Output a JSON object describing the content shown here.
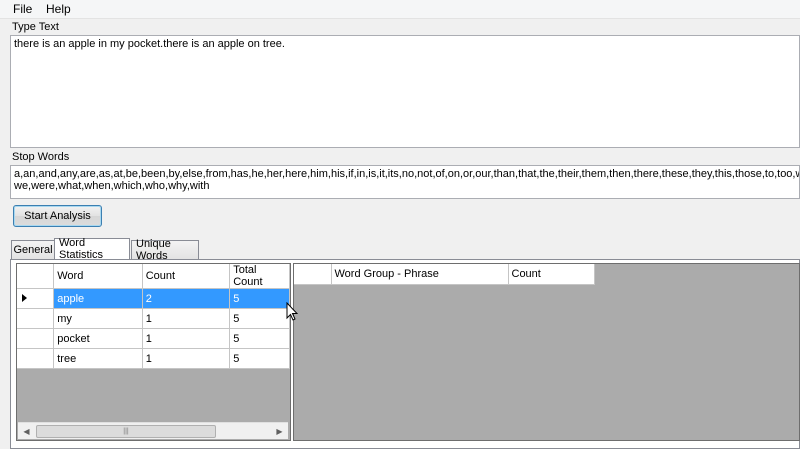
{
  "menu": {
    "file": "File",
    "help": "Help"
  },
  "type_text": {
    "label": "Type Text",
    "value": "there is an apple in my pocket.there is an apple on tree."
  },
  "stop_words": {
    "label": "Stop Words",
    "value": "a,an,and,any,are,as,at,be,been,by,else,from,has,he,her,here,him,his,if,in,is,it,its,no,not,of,on,or,our,than,that,the,their,them,then,there,these,they,this,those,to,too,was,\nwe,were,what,when,which,who,why,with"
  },
  "start_button": "Start Analysis",
  "tabs": [
    {
      "label": "General"
    },
    {
      "label": "Word Statistics"
    },
    {
      "label": "Unique Words"
    }
  ],
  "word_grid": {
    "columns": [
      "Word",
      "Count",
      "Total Count"
    ],
    "rows": [
      {
        "word": "apple",
        "count": "2",
        "total": "5"
      },
      {
        "word": "my",
        "count": "1",
        "total": "5"
      },
      {
        "word": "pocket",
        "count": "1",
        "total": "5"
      },
      {
        "word": "tree",
        "count": "1",
        "total": "5"
      }
    ]
  },
  "phrase_grid": {
    "columns": [
      "Word Group - Phrase",
      "Count"
    ]
  },
  "icons": {
    "row_marker": "triangle-right-icon",
    "scroll_left": "arrow-left-icon",
    "scroll_right": "arrow-right-icon",
    "cursor": "mouse-pointer-icon"
  }
}
